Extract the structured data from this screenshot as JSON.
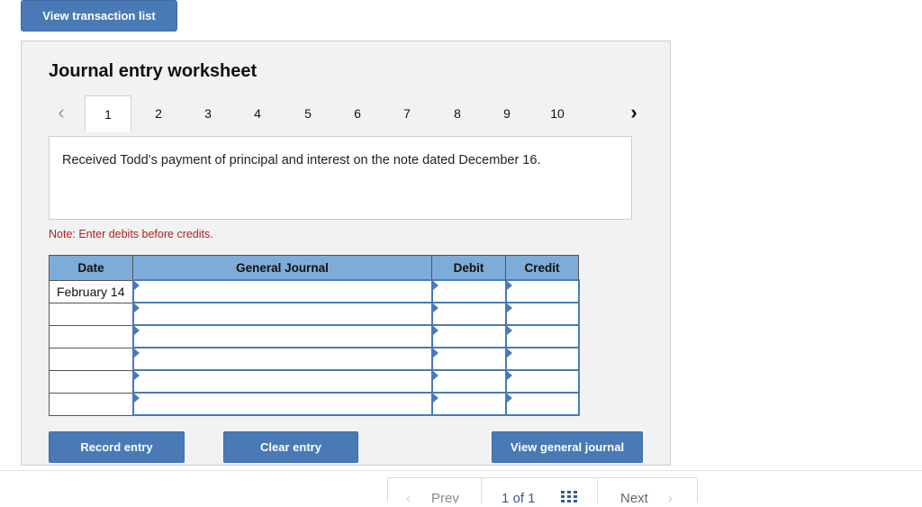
{
  "top_button": "View transaction list",
  "worksheet": {
    "title": "Journal entry worksheet",
    "tabs": [
      "1",
      "2",
      "3",
      "4",
      "5",
      "6",
      "7",
      "8",
      "9",
      "10"
    ],
    "active_tab": "1",
    "description": "Received Todd’s payment of principal and interest on the note dated December 16.",
    "note": "Note: Enter debits before credits."
  },
  "journal": {
    "headers": {
      "date": "Date",
      "general_journal": "General Journal",
      "debit": "Debit",
      "credit": "Credit"
    },
    "rows": [
      {
        "date": "February 14"
      },
      {
        "date": ""
      },
      {
        "date": ""
      },
      {
        "date": ""
      },
      {
        "date": ""
      },
      {
        "date": ""
      }
    ]
  },
  "buttons": {
    "record": "Record entry",
    "clear": "Clear entry",
    "view_general_journal": "View general journal"
  },
  "pager": {
    "prev": "Prev",
    "count": "1 of 1",
    "next": "Next"
  },
  "colors": {
    "button": "#4a7ab6",
    "header": "#7eacd9",
    "note": "#b11f1f"
  }
}
